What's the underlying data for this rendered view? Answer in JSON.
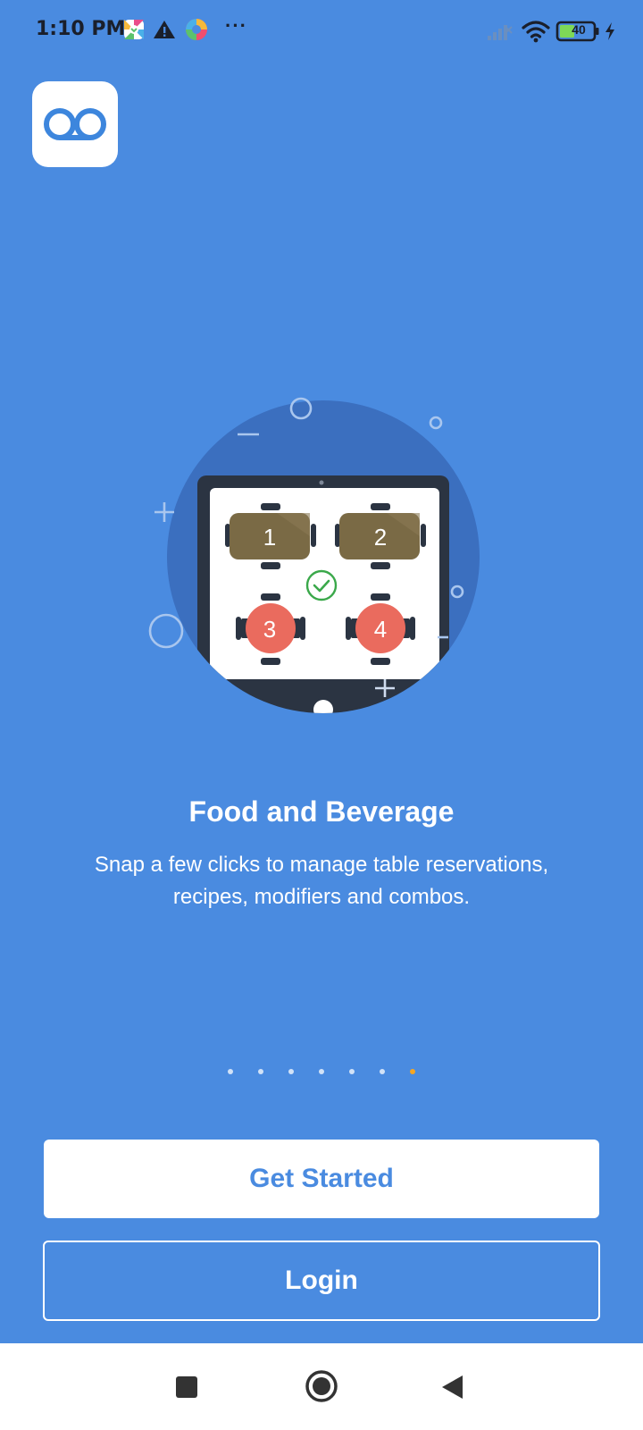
{
  "status_bar": {
    "time": "1:10 PM",
    "more_indicator": "···",
    "battery_level": "40",
    "notification_icons": [
      "pinwheel-app-icon",
      "warning-icon",
      "colorful-app-icon"
    ],
    "system_icons": [
      "signal-icon",
      "wifi-icon",
      "battery-icon",
      "charging-icon"
    ]
  },
  "app": {
    "logo_icon": "qb-logo-icon"
  },
  "onboarding": {
    "title": "Food and Beverage",
    "description_line1": "Snap a few clicks to manage table reservations,",
    "description_line2": "recipes, modifiers and combos.",
    "illustration": {
      "icon": "tablet-table-layout-illustration",
      "tables": [
        "1",
        "2",
        "3",
        "4"
      ]
    },
    "pager": {
      "total": 7,
      "active_index": 6,
      "active_color": "#f5a623",
      "inactive_color": "#ffffff"
    }
  },
  "actions": {
    "get_started_label": "Get Started",
    "login_label": "Login"
  },
  "nav_bar": {
    "recents_icon": "square-icon",
    "home_icon": "circle-home-icon",
    "back_icon": "triangle-back-icon"
  },
  "colors": {
    "background": "#4a8be0",
    "button_text": "#4a8be0",
    "table_rect": "#7a6a45",
    "table_round": "#ea6b5e",
    "check": "#3aa84a"
  }
}
